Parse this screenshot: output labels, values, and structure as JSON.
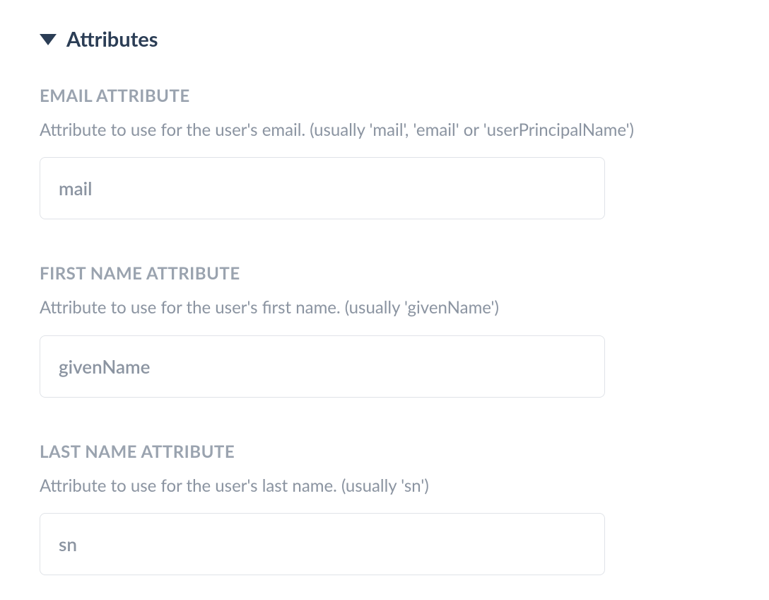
{
  "section": {
    "title": "Attributes"
  },
  "fields": {
    "email": {
      "label": "EMAIL ATTRIBUTE",
      "description": "Attribute to use for the user's email. (usually 'mail', 'email' or 'userPrincipalName')",
      "value": "mail"
    },
    "firstName": {
      "label": "FIRST NAME ATTRIBUTE",
      "description": "Attribute to use for the user's first name. (usually 'givenName')",
      "value": "givenName"
    },
    "lastName": {
      "label": "LAST NAME ATTRIBUTE",
      "description": "Attribute to use for the user's last name. (usually 'sn')",
      "value": "sn"
    }
  }
}
